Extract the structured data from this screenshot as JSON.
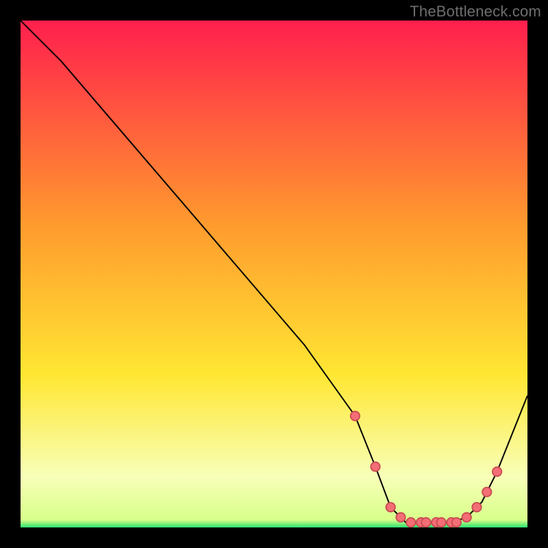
{
  "watermark": "TheBottleneck.com",
  "colors": {
    "bg_black": "#000000",
    "grad_top": "#ff1f4d",
    "grad_mid1": "#ff9a2e",
    "grad_mid2": "#ffe733",
    "grad_pale": "#f8ffb8",
    "grad_green": "#2be36e",
    "line": "#000000",
    "dot_fill": "#f46e75",
    "dot_stroke": "#c94b52"
  },
  "chart_data": {
    "type": "line",
    "title": "",
    "xlabel": "",
    "ylabel": "",
    "xlim": [
      0,
      100
    ],
    "ylim": [
      0,
      100
    ],
    "series": [
      {
        "name": "curve",
        "x": [
          0,
          8,
          20,
          32,
          44,
          56,
          66,
          70,
          73,
          76,
          79,
          82,
          85,
          88,
          91,
          94,
          100
        ],
        "y": [
          100,
          92,
          78,
          64,
          50,
          36,
          22,
          12,
          4,
          1,
          1,
          1,
          1,
          2,
          5,
          11,
          26
        ]
      }
    ],
    "markers": {
      "name": "dots",
      "x": [
        66,
        70,
        73,
        75,
        77,
        79,
        80,
        82,
        83,
        85,
        86,
        88,
        90,
        92,
        94
      ],
      "y": [
        22,
        12,
        4,
        2,
        1,
        1,
        1,
        1,
        1,
        1,
        1,
        2,
        4,
        7,
        11
      ]
    }
  }
}
